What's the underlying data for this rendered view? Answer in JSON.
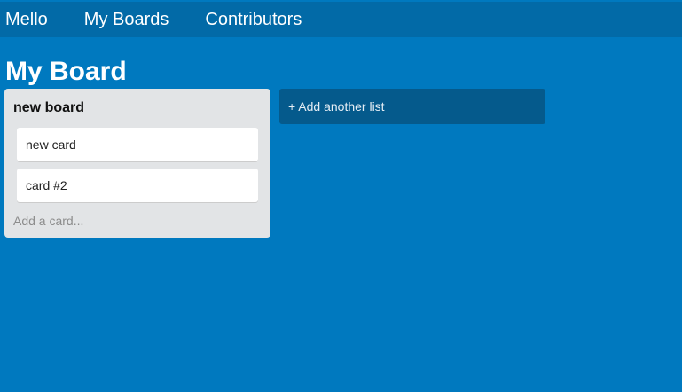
{
  "nav": {
    "brand": "Mello",
    "my_boards": "My Boards",
    "contributors": "Contributors"
  },
  "board": {
    "title": "My Board"
  },
  "lists": [
    {
      "title": "new board",
      "cards": [
        {
          "label": "new card"
        },
        {
          "label": "card #2"
        }
      ],
      "add_card_placeholder": "Add a card..."
    }
  ],
  "add_list_label": "+ Add another list",
  "colors": {
    "background": "#0079bf",
    "topbar": "#026aa7",
    "list_bg": "#e2e4e6",
    "add_list_bg": "#055a8c",
    "card_bg": "#ffffff"
  }
}
